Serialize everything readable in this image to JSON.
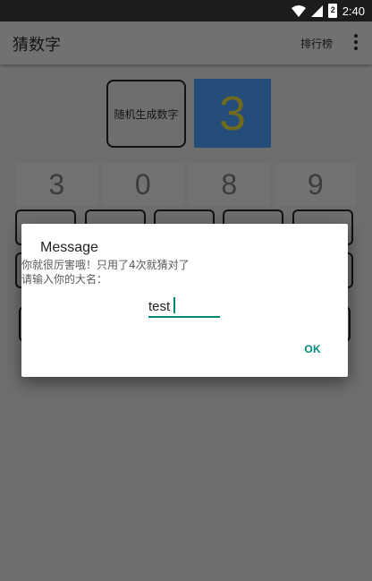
{
  "status_bar": {
    "time": "2:40",
    "battery_level": "2",
    "icons": [
      "wifi-icon",
      "signal-icon",
      "battery-icon"
    ]
  },
  "app_bar": {
    "title": "猜数字",
    "rank_label": "排行榜",
    "overflow_icon": "more-vert-icon"
  },
  "main": {
    "generate_button": "随机生成数字",
    "current_digit": "3",
    "guesses": [
      "3",
      "0",
      "8",
      "9"
    ]
  },
  "dialog": {
    "title": "Message",
    "line1": "你就很厉害哦！只用了4次就猜对了",
    "line2": "请输入你的大名：",
    "input_value": "test",
    "ok_label": "OK"
  },
  "colors": {
    "accent": "#00897b",
    "scrim_background": "#6e6e6e",
    "status_bar": "#1c1c1c",
    "digit_tile": "#254d7a"
  }
}
